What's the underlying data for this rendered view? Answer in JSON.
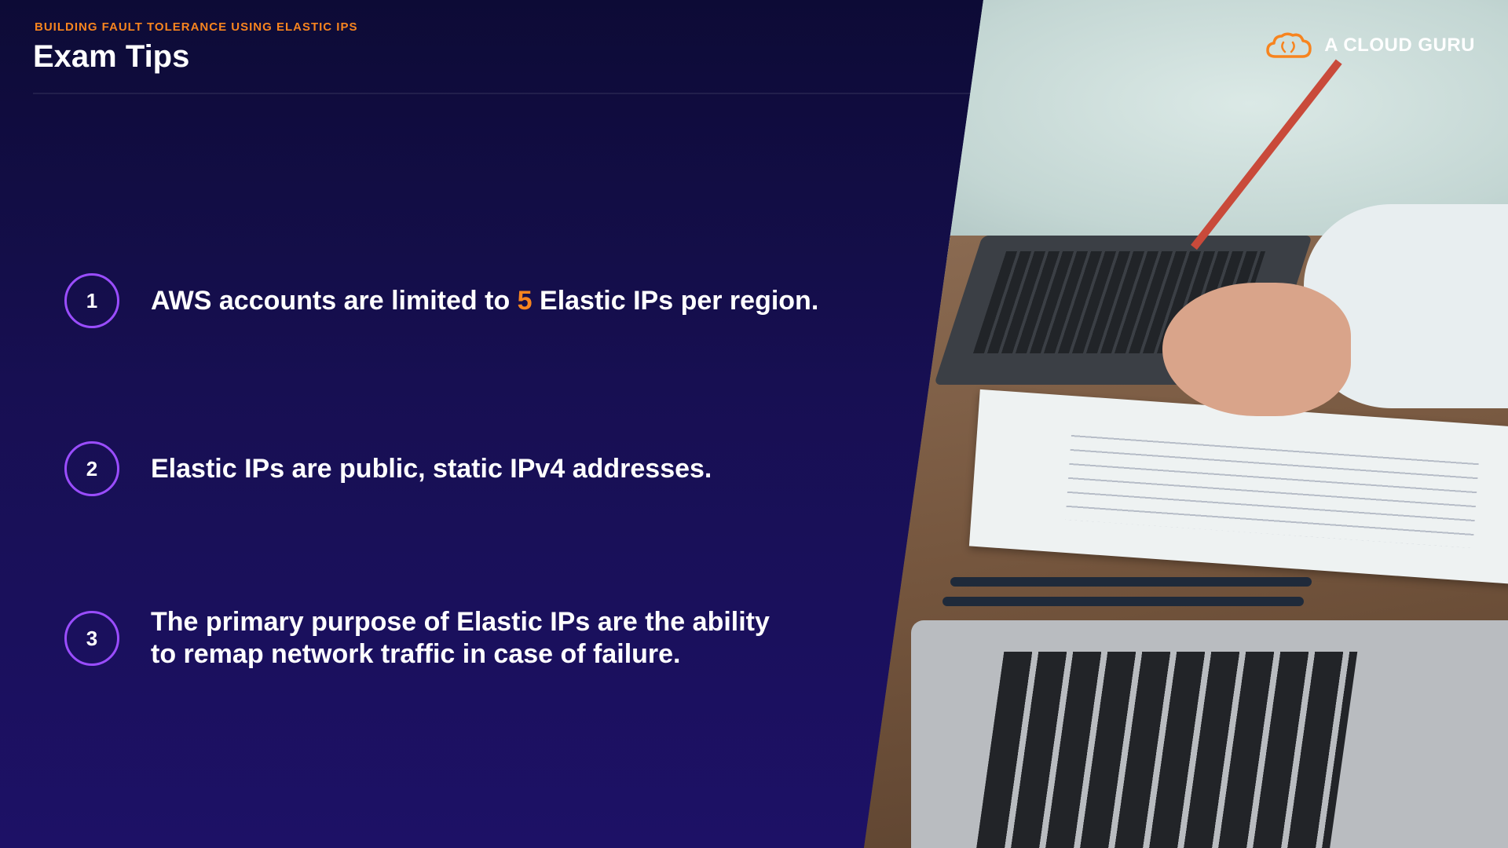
{
  "header": {
    "subtitle": "BUILDING FAULT TOLERANCE USING ELASTIC IPS",
    "title": "Exam Tips"
  },
  "brand": {
    "name": "A CLOUD GURU",
    "icon": "cloud-icon",
    "accent_color": "#f7841f"
  },
  "tips": [
    {
      "number": "1",
      "text_before": "AWS accounts are limited to ",
      "highlight": "5",
      "text_after": " Elastic IPs per region."
    },
    {
      "number": "2",
      "text": "Elastic IPs are public, static IPv4 addresses."
    },
    {
      "number": "3",
      "line1": "The primary purpose of Elastic IPs are the ability",
      "line2": "to remap network traffic in case of failure."
    }
  ],
  "colors": {
    "background_top": "#0d0b36",
    "background_bottom": "#1d1166",
    "number_ring": "#9a4dff",
    "highlight": "#f7841f"
  }
}
